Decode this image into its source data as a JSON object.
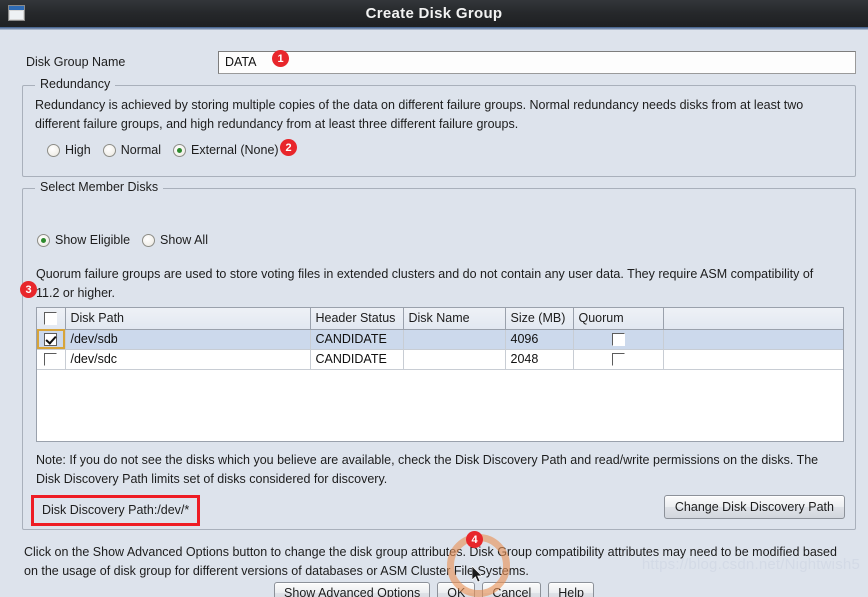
{
  "window": {
    "title": "Create Disk Group",
    "icon": "window-icon"
  },
  "disk_group_name": {
    "label": "Disk Group Name",
    "value": "DATA",
    "placeholder": ""
  },
  "redundancy": {
    "legend": "Redundancy",
    "description": "Redundancy is achieved by storing multiple copies of the data on different failure groups. Normal redundancy needs disks from at least two different failure groups, and high redundancy from at least three different failure groups.",
    "options": [
      {
        "label": "High",
        "checked": false
      },
      {
        "label": "Normal",
        "checked": false
      },
      {
        "label": "External (None)",
        "checked": true
      }
    ]
  },
  "member_disks": {
    "legend": "Select Member Disks",
    "filter_options": [
      {
        "label": "Show Eligible",
        "checked": true
      },
      {
        "label": "Show All",
        "checked": false
      }
    ],
    "quorum_note": "Quorum failure groups are used to store voting files in extended clusters and do not contain any user data. They require ASM compatibility of 11.2 or higher.",
    "table": {
      "headers": [
        "",
        "Disk Path",
        "Header Status",
        "Disk Name",
        "Size (MB)",
        "Quorum"
      ],
      "header_select_all_checked": false,
      "rows": [
        {
          "selected_checkbox": true,
          "row_selected": true,
          "disk_path": "/dev/sdb",
          "header_status": "CANDIDATE",
          "disk_name": "",
          "size_mb": "4096",
          "quorum_checked": false
        },
        {
          "selected_checkbox": false,
          "row_selected": false,
          "disk_path": "/dev/sdc",
          "header_status": "CANDIDATE",
          "disk_name": "",
          "size_mb": "2048",
          "quorum_checked": false
        }
      ]
    },
    "note": "Note: If you do not see the disks which you believe are available, check the Disk Discovery Path and read/write permissions on the disks. The Disk Discovery Path limits set of disks considered for discovery.",
    "discovery_path_text": "Disk Discovery Path:/dev/*",
    "change_path_button": "Change Disk Discovery Path"
  },
  "footer": {
    "advanced_note": "Click on the Show Advanced Options button to change the disk group attributes. Disk Group compatibility attributes may need to be modified based on the usage of disk group for different versions of databases or ASM Cluster File Systems.",
    "buttons": [
      {
        "label": "Show Advanced Options"
      },
      {
        "label": "OK"
      },
      {
        "label": "Cancel"
      },
      {
        "label": "Help"
      }
    ]
  },
  "annotations": {
    "badges": [
      "1",
      "2",
      "3",
      "4"
    ],
    "highlight_color": "#ee1c24",
    "ring_color": "#e89256"
  },
  "watermark": "https://blog.csdn.net/Nightwish5"
}
